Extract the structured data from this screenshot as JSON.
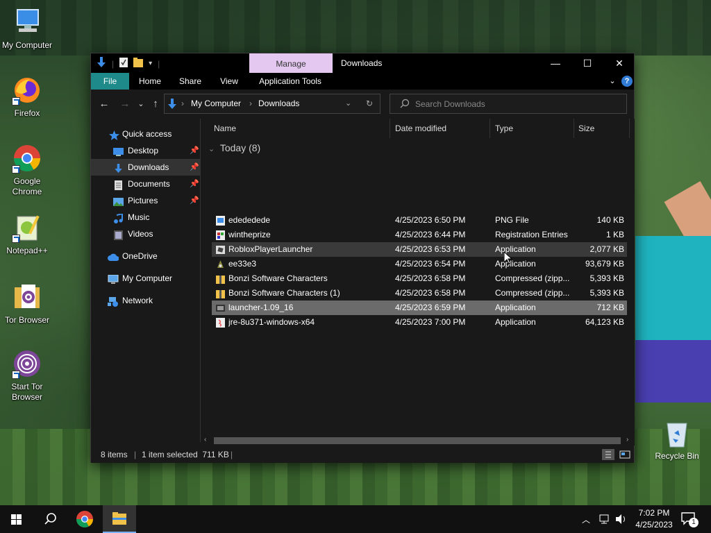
{
  "desktop": {
    "icons": [
      {
        "label": "My Computer"
      },
      {
        "label": "Firefox"
      },
      {
        "label": "Google Chrome"
      },
      {
        "label": "Notepad++"
      },
      {
        "label": "Tor Browser"
      },
      {
        "label": "Start Tor Browser"
      }
    ],
    "recycle_bin": "Recycle Bin"
  },
  "window": {
    "manage_tab": "Manage",
    "title": "Downloads",
    "ribbon_tabs": [
      "File",
      "Home",
      "Share",
      "View",
      "Application Tools"
    ],
    "address": {
      "root": "My Computer",
      "current": "Downloads"
    },
    "search_placeholder": "Search Downloads"
  },
  "nav_pane": {
    "items": [
      {
        "label": "Quick access"
      },
      {
        "label": "Desktop"
      },
      {
        "label": "Downloads"
      },
      {
        "label": "Documents"
      },
      {
        "label": "Pictures"
      },
      {
        "label": "Music"
      },
      {
        "label": "Videos"
      },
      {
        "label": "OneDrive"
      },
      {
        "label": "My Computer"
      },
      {
        "label": "Network"
      }
    ]
  },
  "file_list": {
    "columns": [
      "Name",
      "Date modified",
      "Type",
      "Size"
    ],
    "group": "Today (8)",
    "rows": [
      {
        "name": "edededede",
        "date": "4/25/2023 6:50 PM",
        "type": "PNG File",
        "size": "140 KB"
      },
      {
        "name": "wintheprize",
        "date": "4/25/2023 6:44 PM",
        "type": "Registration Entries",
        "size": "1 KB"
      },
      {
        "name": "RobloxPlayerLauncher",
        "date": "4/25/2023 6:53 PM",
        "type": "Application",
        "size": "2,077 KB"
      },
      {
        "name": "ee33e3",
        "date": "4/25/2023 6:54 PM",
        "type": "Application",
        "size": "93,679 KB"
      },
      {
        "name": "Bonzi Software Characters",
        "date": "4/25/2023 6:58 PM",
        "type": "Compressed (zipp...",
        "size": "5,393 KB"
      },
      {
        "name": "Bonzi Software Characters (1)",
        "date": "4/25/2023 6:58 PM",
        "type": "Compressed (zipp...",
        "size": "5,393 KB"
      },
      {
        "name": "launcher-1.09_16",
        "date": "4/25/2023 6:59 PM",
        "type": "Application",
        "size": "712 KB"
      },
      {
        "name": "jre-8u371-windows-x64",
        "date": "4/25/2023 7:00 PM",
        "type": "Application",
        "size": "64,123 KB"
      }
    ]
  },
  "status": {
    "items": "8 items",
    "selection": "1 item selected  711 KB"
  },
  "taskbar": {
    "time": "7:02 PM",
    "date": "4/25/2023",
    "notification_count": "1"
  }
}
